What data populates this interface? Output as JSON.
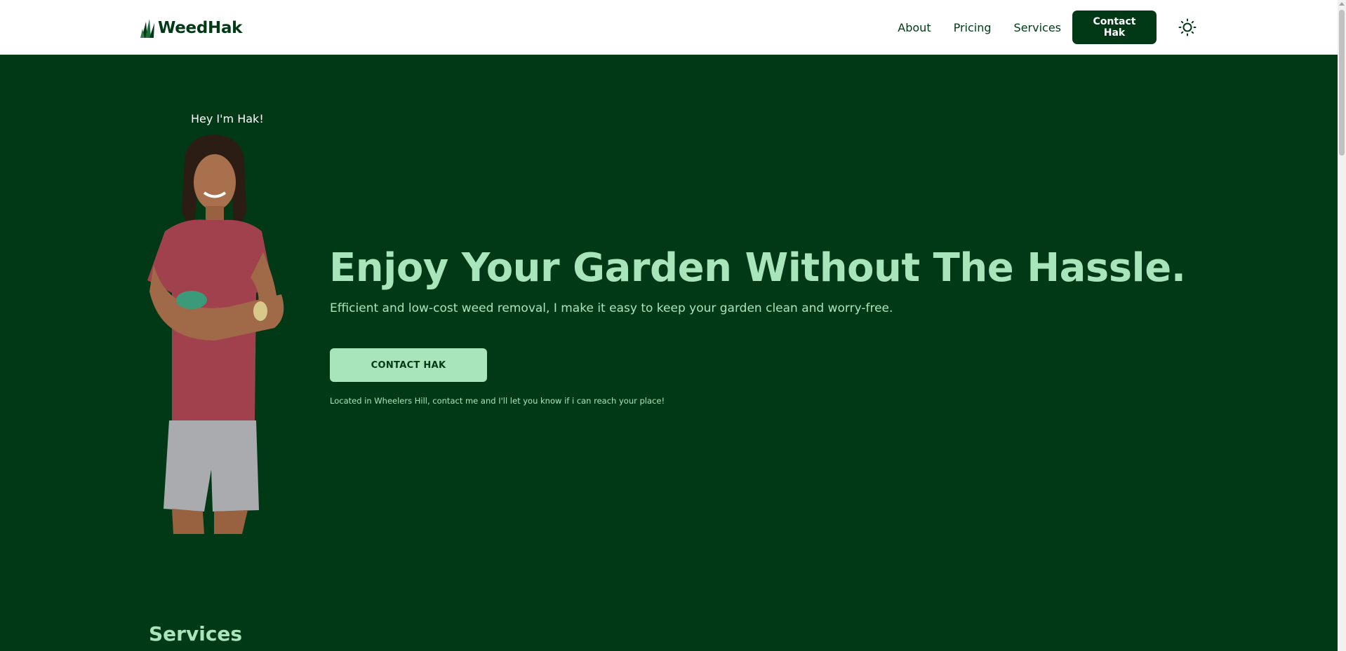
{
  "brand": {
    "name": "WeedHak",
    "logo_icon": "grass-leaf-icon"
  },
  "nav": {
    "links": [
      {
        "label": "About"
      },
      {
        "label": "Pricing"
      },
      {
        "label": "Services"
      }
    ],
    "cta_label": "Contact Hak",
    "theme_icon": "sun-icon"
  },
  "hero": {
    "greeting": "Hey I'm Hak!",
    "title": "Enjoy Your Garden Without The Hassle.",
    "subtitle": "Efficient and low-cost weed removal, I make it easy to keep your garden clean and worry-free.",
    "cta_label": "CONTACT HAK",
    "note": "Located in Wheelers Hill, contact me and I'll let you know if i can reach your place!"
  },
  "services": {
    "title": "Services"
  },
  "colors": {
    "brand_dark": "#013916",
    "accent_light": "#a9e5bb",
    "header_bg": "#ffffff"
  }
}
